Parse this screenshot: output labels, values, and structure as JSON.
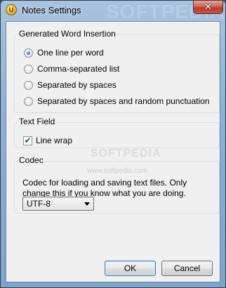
{
  "window": {
    "title": "Notes Settings",
    "app_icon_glyph": "U",
    "close_glyph": "✕",
    "watermark": "SOFTPEDIA"
  },
  "word_insertion": {
    "title": "Generated Word Insertion",
    "options": [
      {
        "label": "One line per word",
        "checked": true
      },
      {
        "label": "Comma-separated list",
        "checked": false
      },
      {
        "label": "Separated by spaces",
        "checked": false
      },
      {
        "label": "Separated by spaces and random punctuation",
        "checked": false
      }
    ]
  },
  "text_field": {
    "title": "Text Field",
    "line_wrap_label": "Line wrap",
    "line_wrap_checked": true,
    "check_glyph": "✔"
  },
  "codec": {
    "title": "Codec",
    "description": "Codec for loading and saving text files. Only change this if you know what you are doing.",
    "selected": "UTF-8"
  },
  "buttons": {
    "ok": "OK",
    "cancel": "Cancel"
  },
  "watermark_text": "SOFTPEDIA",
  "watermark_url": "www.softpedia.com"
}
